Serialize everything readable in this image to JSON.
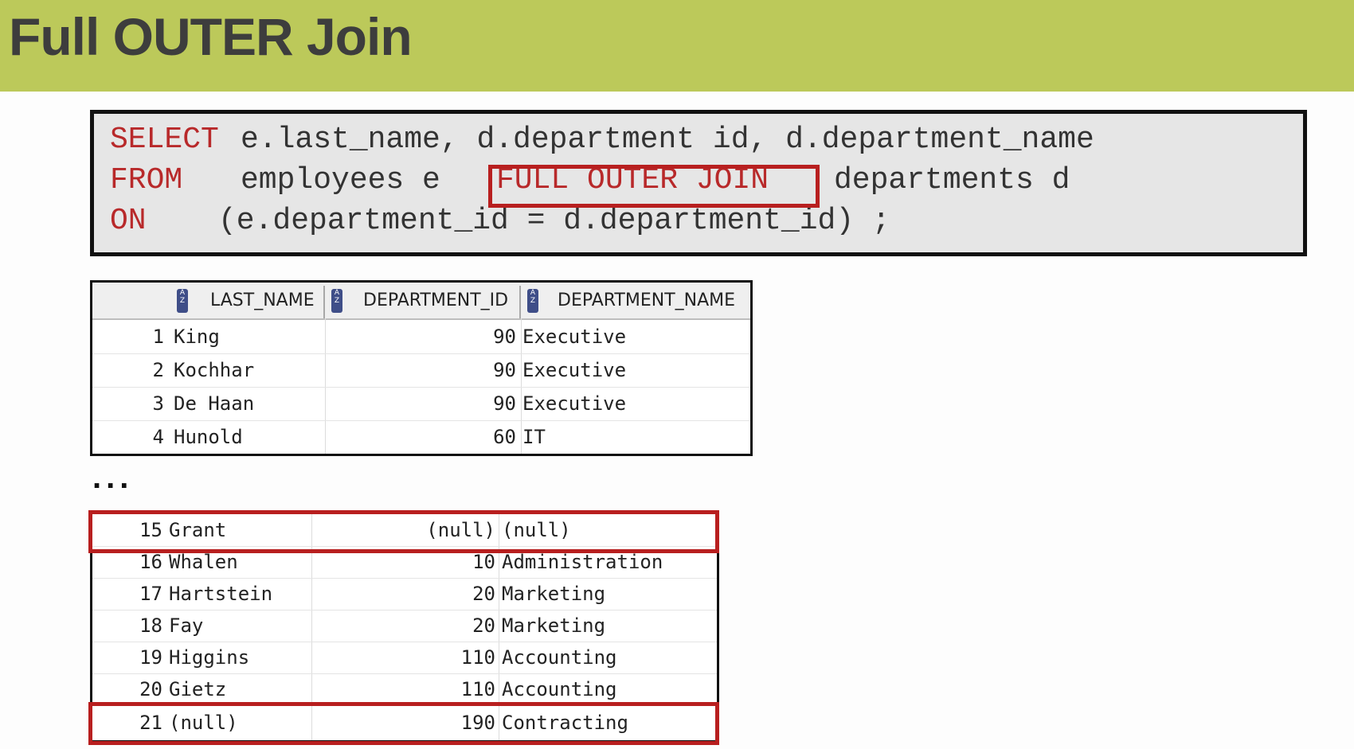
{
  "slide": {
    "title": "Full OUTER Join"
  },
  "sql": {
    "line1_kw": "SELECT",
    "line1_rest": "e.last_name, d.department id, d.department_name",
    "line2_kw": "FROM",
    "line2_mid": "employees e",
    "line2_join": "FULL OUTER JOIN",
    "line2_rest": "departments d",
    "line3_kw": "ON",
    "line3_rest": "(e.department_id = d.department_id) ;"
  },
  "result_top": {
    "columns": [
      "LAST_NAME",
      "DEPARTMENT_ID",
      "DEPARTMENT_NAME"
    ],
    "sort_icon": "sort-icon",
    "rows": [
      {
        "n": "1",
        "last_name": "King",
        "dept_id": "90",
        "dept_name": "Executive"
      },
      {
        "n": "2",
        "last_name": "Kochhar",
        "dept_id": "90",
        "dept_name": "Executive"
      },
      {
        "n": "3",
        "last_name": "De Haan",
        "dept_id": "90",
        "dept_name": "Executive"
      },
      {
        "n": "4",
        "last_name": "Hunold",
        "dept_id": "60",
        "dept_name": "IT"
      }
    ]
  },
  "ellipsis": "...",
  "result_bottom": {
    "rows": [
      {
        "n": "15",
        "last_name": "Grant",
        "dept_id": "(null)",
        "dept_name": "(null)"
      },
      {
        "n": "16",
        "last_name": "Whalen",
        "dept_id": "10",
        "dept_name": "Administration"
      },
      {
        "n": "17",
        "last_name": "Hartstein",
        "dept_id": "20",
        "dept_name": "Marketing"
      },
      {
        "n": "18",
        "last_name": "Fay",
        "dept_id": "20",
        "dept_name": "Marketing"
      },
      {
        "n": "19",
        "last_name": "Higgins",
        "dept_id": "110",
        "dept_name": "Accounting"
      },
      {
        "n": "20",
        "last_name": "Gietz",
        "dept_id": "110",
        "dept_name": "Accounting"
      },
      {
        "n": "21",
        "last_name": "(null)",
        "dept_id": "190",
        "dept_name": "Contracting"
      }
    ]
  },
  "colors": {
    "title_bar": "#bcc95a",
    "keyword": "#b8292a",
    "highlight": "#b81f1f"
  }
}
